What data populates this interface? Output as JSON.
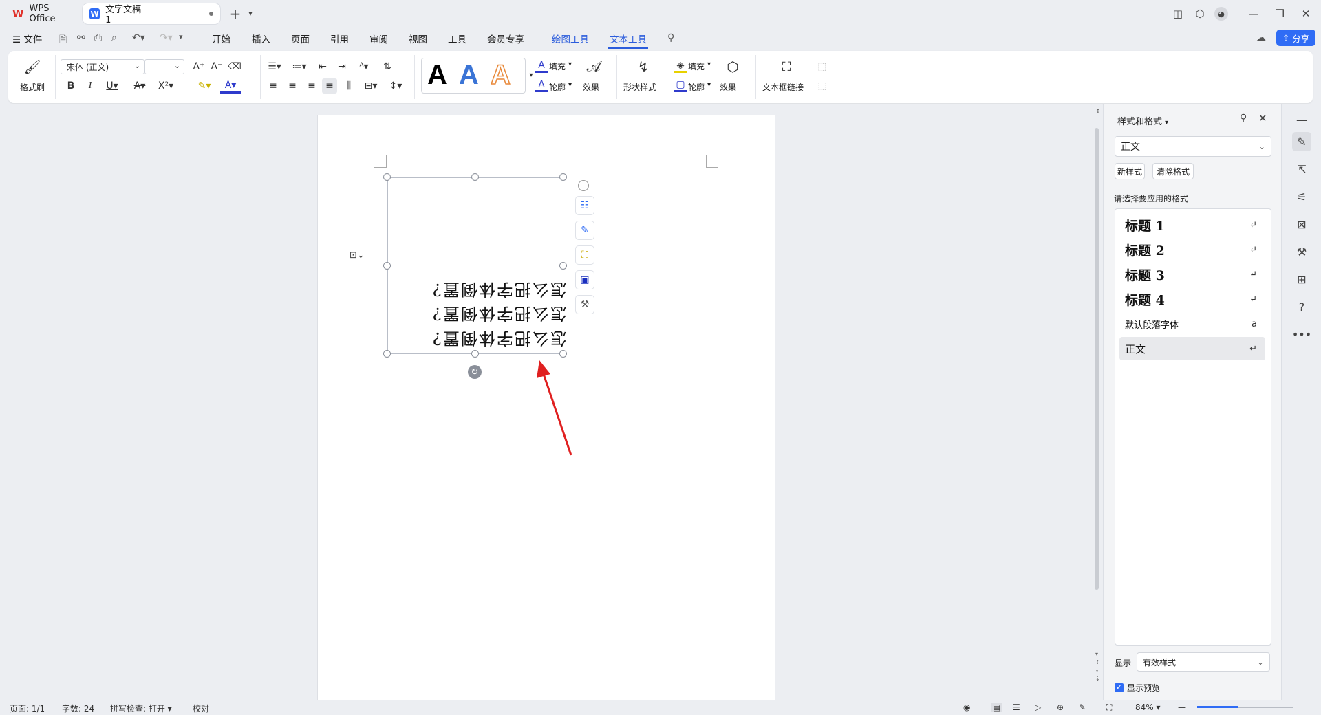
{
  "titlebar": {
    "app_tab": "WPS Office",
    "doc_tab": "文字文稿1",
    "new_tab": "+"
  },
  "menu": {
    "file": "文件",
    "items": [
      "开始",
      "插入",
      "页面",
      "引用",
      "审阅",
      "视图",
      "工具",
      "会员专享"
    ],
    "drawing_tools": "绘图工具",
    "text_tools": "文本工具",
    "share": "分享"
  },
  "ribbon": {
    "format_painter": "格式刷",
    "font_name": "宋体 (正文)",
    "font_size": "",
    "fill1": "填充",
    "outline1": "轮廓",
    "effect1": "效果",
    "shape_style": "形状样式",
    "fill2": "填充",
    "outline2": "轮廓",
    "effect2": "效果",
    "textbox_link": "文本框链接",
    "art_samples": [
      "A",
      "A",
      "A"
    ]
  },
  "document": {
    "lines": [
      "怎么把字体倒置?",
      "怎么把字体倒置?",
      "怎么把字体倒置?"
    ]
  },
  "panel": {
    "title": "样式和格式",
    "current_style": "正文",
    "new_style": "新样式",
    "clear_format": "清除格式",
    "prompt": "请选择要应用的格式",
    "styles": [
      "标题  1",
      "标题  2",
      "标题  3",
      "标题  4",
      "默认段落字体",
      "正文"
    ],
    "show_label": "显示",
    "show_value": "有效样式",
    "preview": "显示预览"
  },
  "status": {
    "page": "页面: 1/1",
    "words": "字数: 24",
    "spell": "拼写检查: 打开",
    "proof": "校对",
    "zoom": "84%"
  },
  "colors": {
    "accent": "#2f6cf5",
    "arrow": "#e02020",
    "wps_red": "#e0322b"
  }
}
